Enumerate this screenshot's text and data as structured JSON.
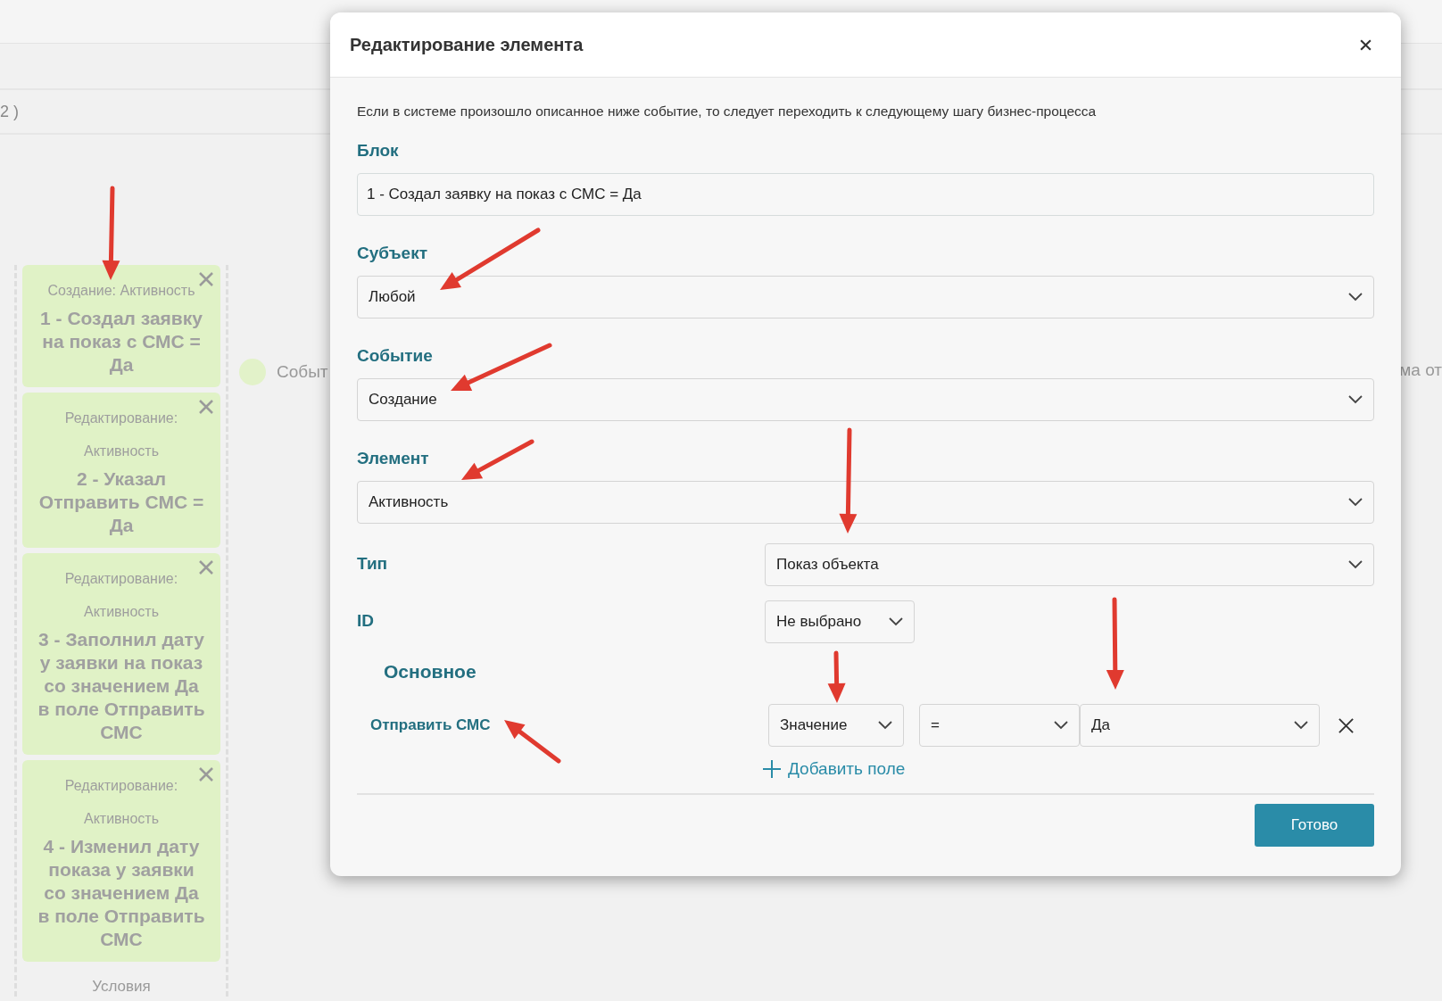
{
  "background": {
    "tab_fragment": "2 )",
    "legend_label": "Событ",
    "right_fragment": "ма от",
    "cards": [
      {
        "event": "Создание: Активность",
        "title": "1 - Создал заявку на показ с СМС = Да"
      },
      {
        "event": "Редактирование: Активность",
        "title": "2 - Указал Отправить СМС = Да"
      },
      {
        "event": "Редактирование: Активность",
        "title": "3 - Заполнил дату у заявки на показ со значением Да в поле Отправить СМС"
      },
      {
        "event": "Редактирование: Активность",
        "title": "4 - Изменил дату показа у заявки со значением Да в поле Отправить СМС"
      }
    ],
    "footer": "Условия"
  },
  "dialog": {
    "title": "Редактирование элемента",
    "description": "Если в системе произошло описанное ниже событие, то следует переходить к следующему шагу бизнес-процесса",
    "block": {
      "label": "Блок",
      "value": "1 - Создал заявку на показ с СМС = Да"
    },
    "stacked_fields": [
      {
        "label": "Субъект",
        "value": "Любой"
      },
      {
        "label": "Событие",
        "value": "Создание"
      },
      {
        "label": "Элемент",
        "value": "Активность"
      }
    ],
    "type": {
      "label": "Тип",
      "value": "Показ объекта"
    },
    "id": {
      "label": "ID",
      "value": "Не выбрано"
    },
    "section": "Основное",
    "condition": {
      "field": "Отправить СМС",
      "mode": "Значение",
      "operator": "=",
      "value": "Да"
    },
    "add_field": "Добавить поле",
    "done": "Готово"
  }
}
